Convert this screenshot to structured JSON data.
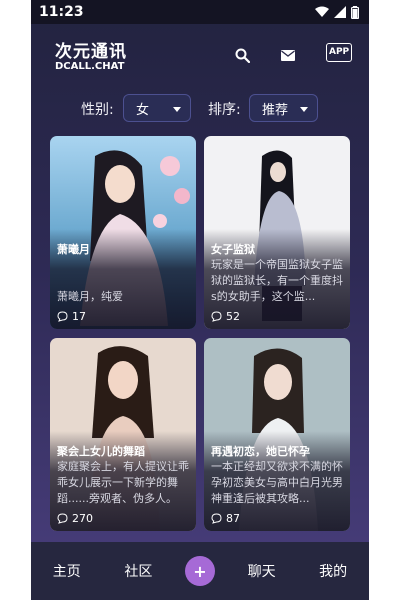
{
  "status": {
    "time": "11:23"
  },
  "header": {
    "title": "次元通讯",
    "subtitle": "DCALL.CHAT",
    "app_badge": "APP"
  },
  "filters": {
    "gender_label": "性别:",
    "gender_value": "女",
    "sort_label": "排序:",
    "sort_value": "推荐"
  },
  "cards": [
    {
      "title": "萧曦月",
      "desc": "萧曦月，纯爱",
      "count": "17"
    },
    {
      "title": "女子监狱",
      "desc": "玩家是一个帝国监狱女子监狱的监狱长，有一个重度抖s的女助手，这个监...",
      "count": "52"
    },
    {
      "title": "聚会上女儿的舞蹈",
      "desc": "家庭聚会上，有人提议让乖乖女儿展示一下新学的舞蹈......旁观者、伪多人。",
      "count": "270"
    },
    {
      "title": "再遇初恋，她已怀孕",
      "desc": "一本正经却又欲求不满的怀孕初恋美女与高中白月光男神重逢后被其攻略...",
      "count": "87"
    }
  ],
  "tabbar": {
    "home": "主页",
    "community": "社区",
    "add": "+",
    "chat": "聊天",
    "mine": "我的"
  },
  "colors": {
    "accent": "#a66ad6",
    "background": "#2e2a55"
  }
}
